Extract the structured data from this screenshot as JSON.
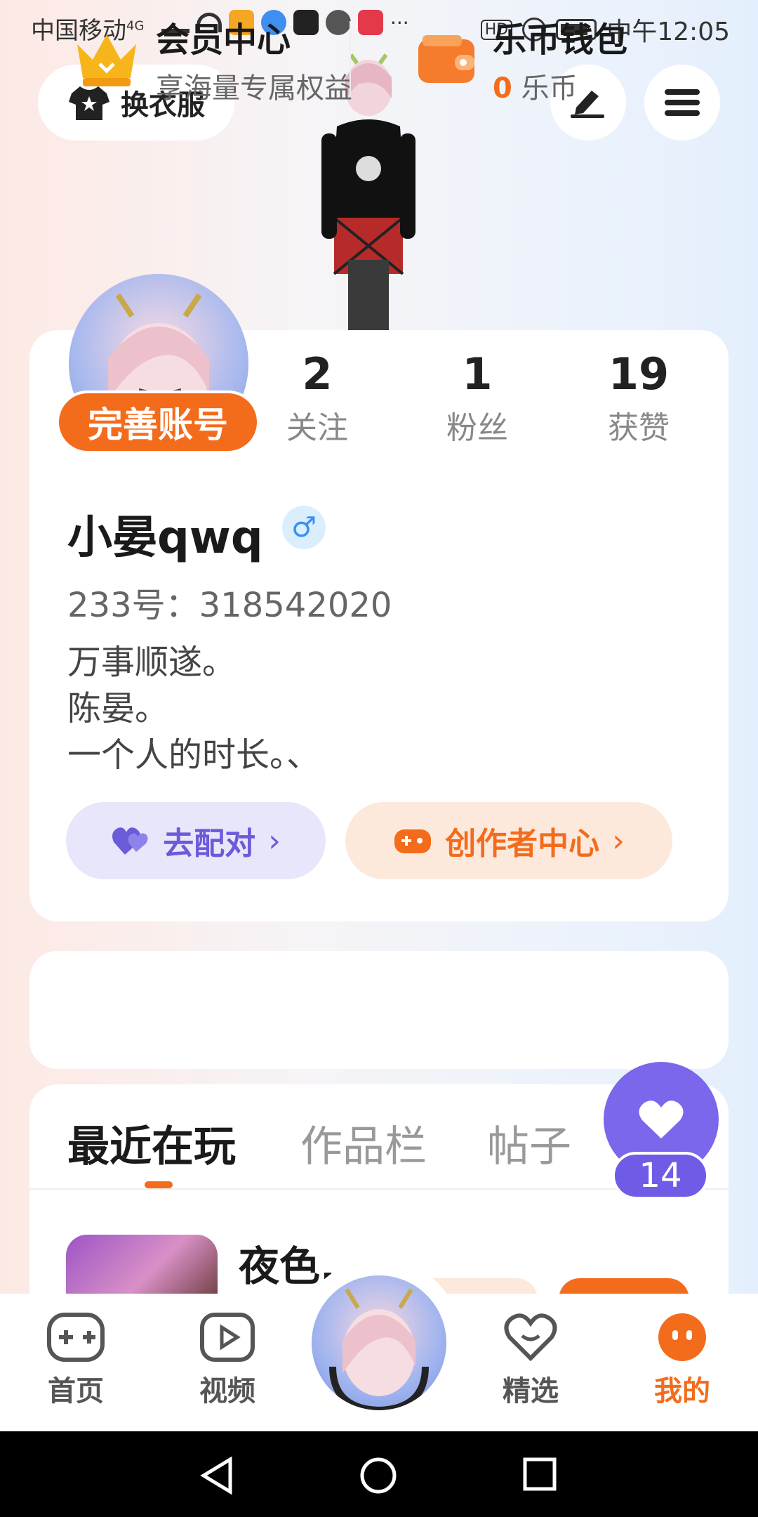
{
  "status_bar": {
    "carrier": "中国移动",
    "network": "4G",
    "hd": "HD",
    "time": "中午12:05"
  },
  "top": {
    "outfit_button": "换衣服",
    "edit_icon": "edit-icon",
    "menu_icon": "menu-icon"
  },
  "profile": {
    "complete_account": "完善账号",
    "stats": [
      {
        "value": "2",
        "label": "关注"
      },
      {
        "value": "1",
        "label": "粉丝"
      },
      {
        "value": "19",
        "label": "获赞"
      }
    ],
    "nickname": "小晏qwq",
    "gender_symbol": "♂",
    "uid": "233号：318542020",
    "bio": [
      "万事顺遂。",
      "陈晏。",
      "一个人的时长。、"
    ],
    "match_button": "去配对",
    "creator_button": "创作者中心"
  },
  "vip": {
    "member_title": "会员中心",
    "member_sub": "享海量专属权益",
    "wallet_title": "乐币钱包",
    "wallet_amount": "0",
    "wallet_unit": "乐币"
  },
  "tabs": [
    "最近在玩",
    "作品栏",
    "帖子"
  ],
  "recent_game": {
    "title": "夜色."
  },
  "like_fab": {
    "count": "14"
  },
  "bottom_nav": {
    "home": "首页",
    "video": "视频",
    "featured": "精选",
    "mine": "我的"
  },
  "colors": {
    "accent": "#f36c1c",
    "purple": "#7a67ec"
  }
}
